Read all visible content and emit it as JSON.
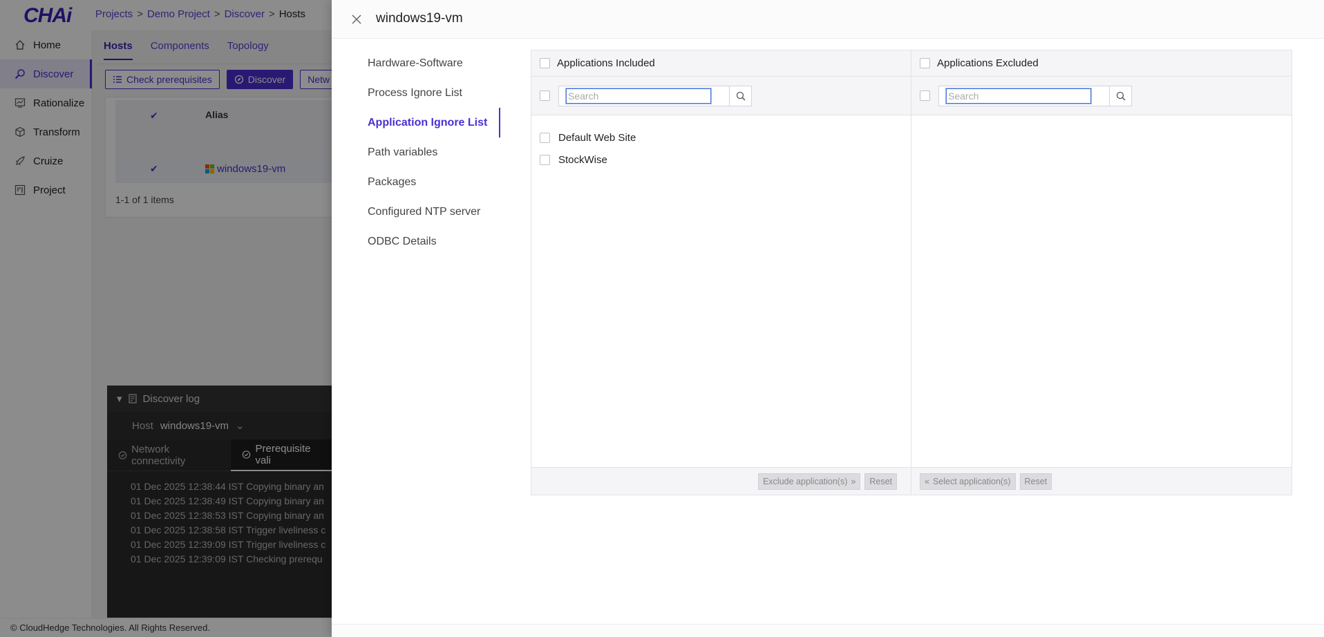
{
  "app": {
    "logo": "CHAi",
    "breadcrumb": [
      "Projects",
      "Demo Project",
      "Discover",
      "Hosts"
    ],
    "breadcrumb_sep": ">",
    "nav": [
      {
        "label": "Home",
        "icon": "home-icon"
      },
      {
        "label": "Discover",
        "icon": "discover-icon"
      },
      {
        "label": "Rationalize",
        "icon": "rationalize-icon"
      },
      {
        "label": "Transform",
        "icon": "transform-icon"
      },
      {
        "label": "Cruize",
        "icon": "cruize-icon"
      },
      {
        "label": "Project",
        "icon": "project-icon"
      }
    ],
    "active_nav": "Discover",
    "tabs": [
      "Hosts",
      "Components",
      "Topology"
    ],
    "active_tab": "Hosts",
    "toolbar": {
      "check_prereq": "Check prerequisites",
      "discover": "Discover",
      "network": "Netw"
    },
    "table": {
      "alias_header": "Alias",
      "row_host": "windows19-vm",
      "count": "1-1 of 1 items"
    },
    "log": {
      "title": "Discover log",
      "host_label": "Host",
      "host_value": "windows19-vm",
      "tabs": [
        "Network connectivity",
        "Prerequisite vali"
      ],
      "lines": [
        "01 Dec 2025 12:38:44 IST Copying binary an",
        "01 Dec 2025 12:38:49 IST Copying binary an",
        "01 Dec 2025 12:38:53 IST Copying binary an",
        "01 Dec 2025 12:38:58 IST Trigger liveliness c",
        "01 Dec 2025 12:39:09 IST Trigger liveliness c",
        "01 Dec 2025 12:39:09 IST Checking prerequ"
      ]
    },
    "footer": "© CloudHedge Technologies. All Rights Reserved."
  },
  "drawer": {
    "title": "windows19-vm",
    "menu": [
      "Hardware-Software",
      "Process Ignore List",
      "Application Ignore List",
      "Path variables",
      "Packages",
      "Configured NTP server",
      "ODBC Details"
    ],
    "active_menu": "Application Ignore List",
    "included": {
      "title": "Applications Included",
      "search_placeholder": "Search",
      "items": [
        "Default Web Site",
        "StockWise"
      ],
      "action_button": "Exclude application(s)",
      "reset_button": "Reset"
    },
    "excluded": {
      "title": "Applications Excluded",
      "search_placeholder": "Search",
      "items": [],
      "action_button": "Select application(s)",
      "reset_button": "Reset"
    }
  },
  "colors": {
    "accent": "#4b2fd1",
    "overlay": "#000000"
  }
}
